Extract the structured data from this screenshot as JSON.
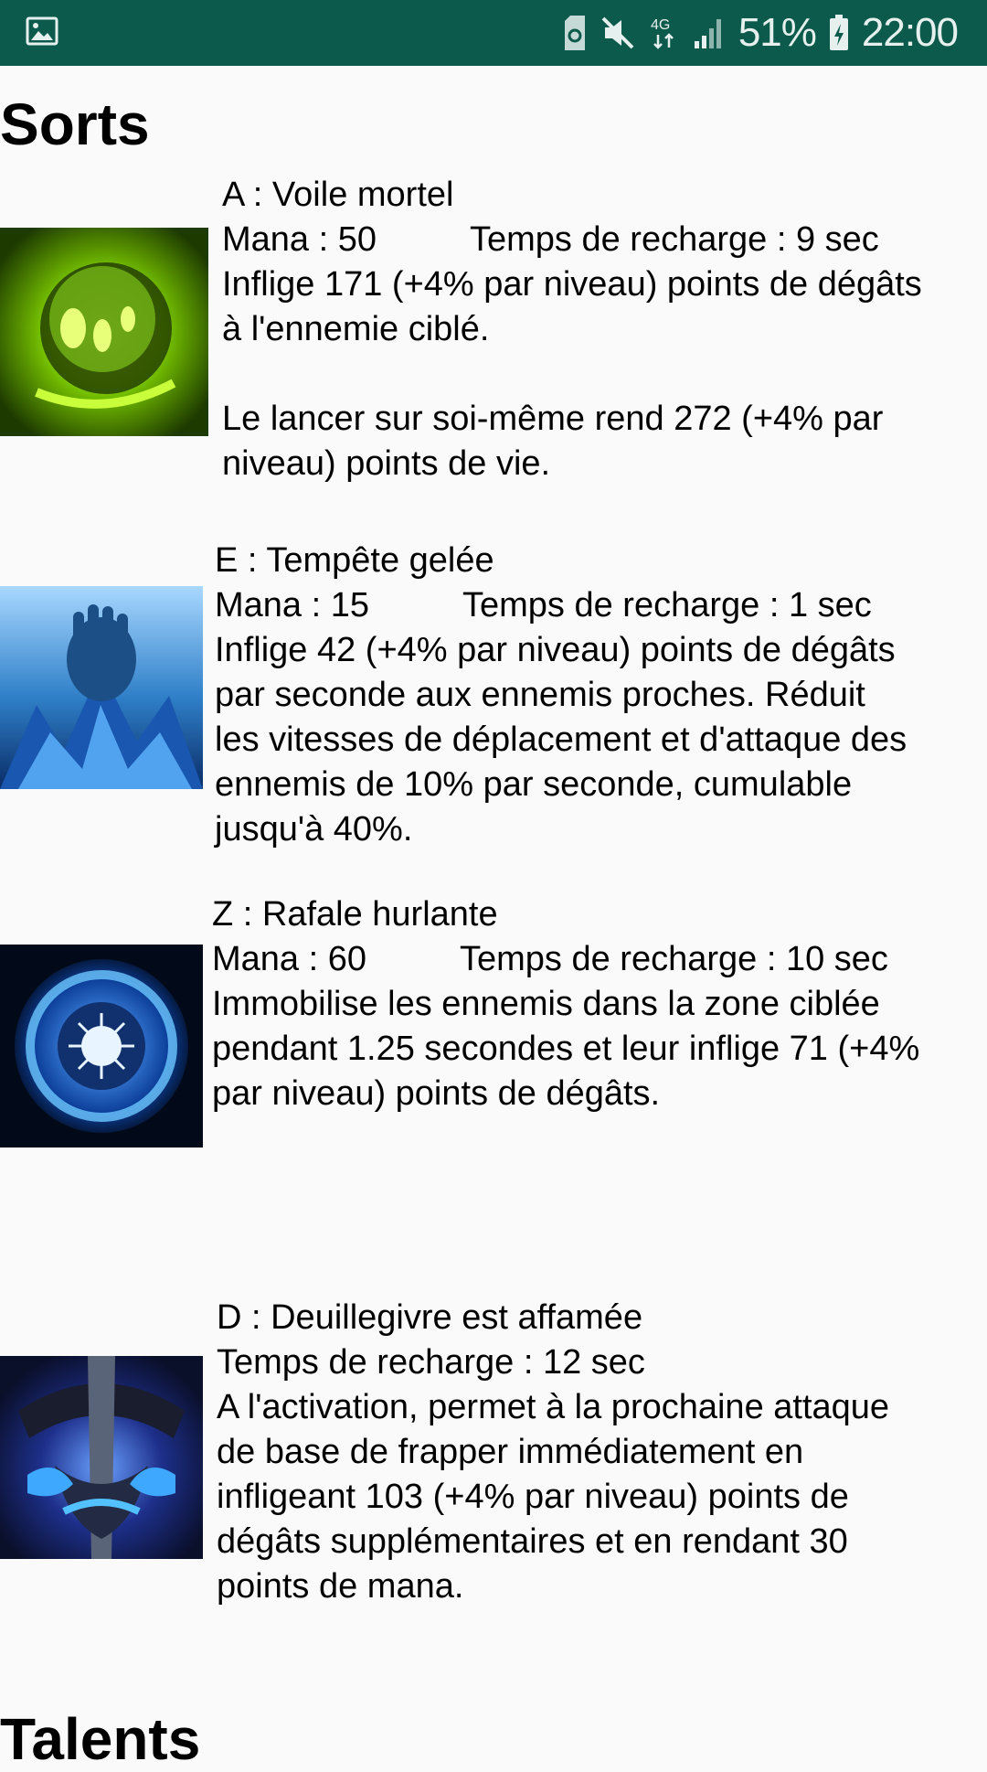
{
  "status_bar": {
    "battery": "51%",
    "time": "22:00",
    "network": "4G",
    "icons": [
      "image-icon",
      "sim-icon",
      "mute-icon",
      "network-4g-icon",
      "signal-icon",
      "battery-icon"
    ]
  },
  "sections": {
    "spells_title": "Sorts",
    "talents_title": "Talents"
  },
  "spells": [
    {
      "title": "A : Voile mortel",
      "mana": "Mana : 50",
      "cooldown": "Temps de recharge : 9 sec",
      "desc_lines": [
        "Inflige 171 (+4% par niveau) points de dégâts",
        "à l'ennemie ciblé."
      ],
      "desc2_lines": [
        "Le lancer sur soi-même rend 272 (+4% par",
        "niveau) points de vie."
      ],
      "icon": "death-coil-icon"
    },
    {
      "title": "E : Tempête gelée",
      "mana": "Mana : 15",
      "cooldown": "Temps de recharge : 1 sec",
      "desc_lines": [
        "Inflige 42 (+4% par niveau) points de dégâts",
        "par seconde aux ennemis proches. Réduit",
        "les vitesses de déplacement et d'attaque des",
        "ennemis de 10% par seconde, cumulable",
        "jusqu'à 40%."
      ],
      "icon": "frost-storm-icon"
    },
    {
      "title": "Z : Rafale hurlante",
      "mana": "Mana : 60",
      "cooldown": "Temps de recharge : 10 sec",
      "desc_lines": [
        "Immobilise les ennemis dans la zone ciblée",
        "pendant 1.25 secondes et leur inflige 71 (+4%",
        "par niveau) points de dégâts."
      ],
      "icon": "howling-blast-icon"
    },
    {
      "title": "D : Deuillegivre est affamée",
      "cooldown": "Temps de recharge : 12 sec",
      "desc_lines": [
        "A l'activation, permet à la prochaine attaque",
        "de base de frapper immédiatement en",
        "infligeant 103 (+4% par niveau) points de",
        "dégâts supplémentaires et en rendant 30",
        "points de mana."
      ],
      "icon": "frostmourne-icon"
    }
  ]
}
